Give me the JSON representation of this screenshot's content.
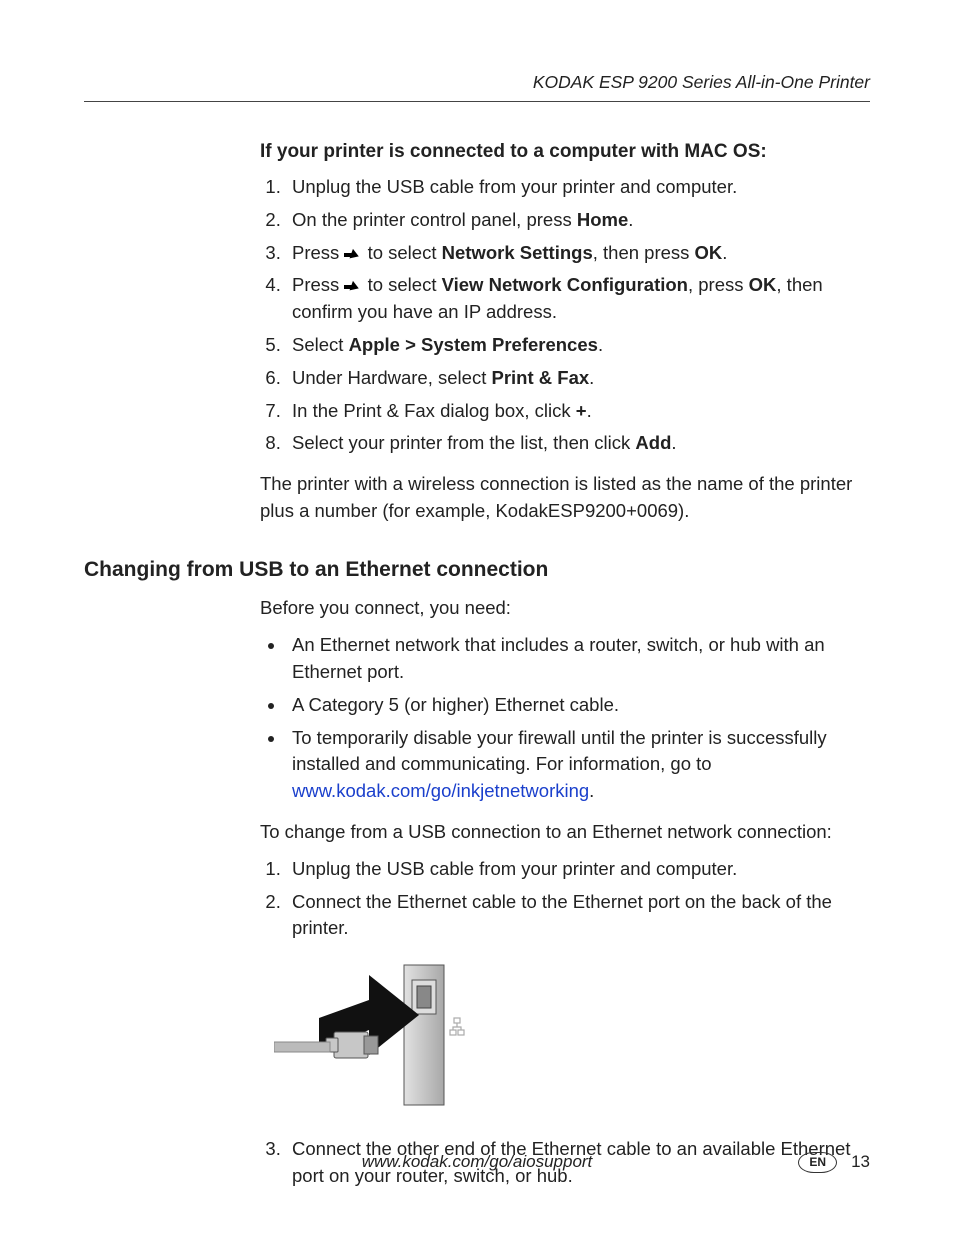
{
  "header": {
    "title": "KODAK ESP 9200 Series All-in-One Printer"
  },
  "mac": {
    "heading": "If your printer is connected to a computer with MAC OS:",
    "steps": {
      "s1": "Unplug the USB cable from your printer and computer.",
      "s2a": "On the printer control panel, press ",
      "s2b": "Home",
      "s2c": ".",
      "s3a": "Press ",
      "s3b": " to select ",
      "s3c": "Network Settings",
      "s3d": ", then press ",
      "s3e": "OK",
      "s3f": ".",
      "s4a": "Press ",
      "s4b": " to select ",
      "s4c": "View Network Configuration",
      "s4d": ", press ",
      "s4e": "OK",
      "s4f": ", then confirm you have an IP address.",
      "s5a": "Select ",
      "s5b": "Apple > System Preferences",
      "s5c": ".",
      "s6a": "Under Hardware, select ",
      "s6b": "Print & Fax",
      "s6c": ".",
      "s7a": "In the Print & Fax dialog box, click ",
      "s7b": "+",
      "s7c": ".",
      "s8a": "Select your printer from the list, then click ",
      "s8b": "Add",
      "s8c": "."
    },
    "after": "The printer with a wireless connection is listed as the name of the printer plus a number (for example, KodakESP9200+0069)."
  },
  "eth": {
    "heading": "Changing from USB to an Ethernet connection",
    "intro": "Before you connect, you need:",
    "bullets": {
      "b1": "An Ethernet network that includes a router, switch, or hub with an Ethernet port.",
      "b2": "A Category 5 (or higher) Ethernet cable.",
      "b3a": "To temporarily disable your firewall until the printer is successfully installed and communicating. For information, go to ",
      "b3link": "www.kodak.com/go/inkjetnetworking",
      "b3c": "."
    },
    "intro2": "To change from a USB connection to an Ethernet network connection:",
    "steps": {
      "s1": "Unplug the USB cable from your printer and computer.",
      "s2": "Connect the Ethernet cable to the Ethernet port on the back of the printer.",
      "s3": "Connect the other end of the Ethernet cable to an available Ethernet port on your router, switch, or hub."
    }
  },
  "footer": {
    "url": "www.kodak.com/go/aiosupport",
    "lang": "EN",
    "page": "13"
  }
}
